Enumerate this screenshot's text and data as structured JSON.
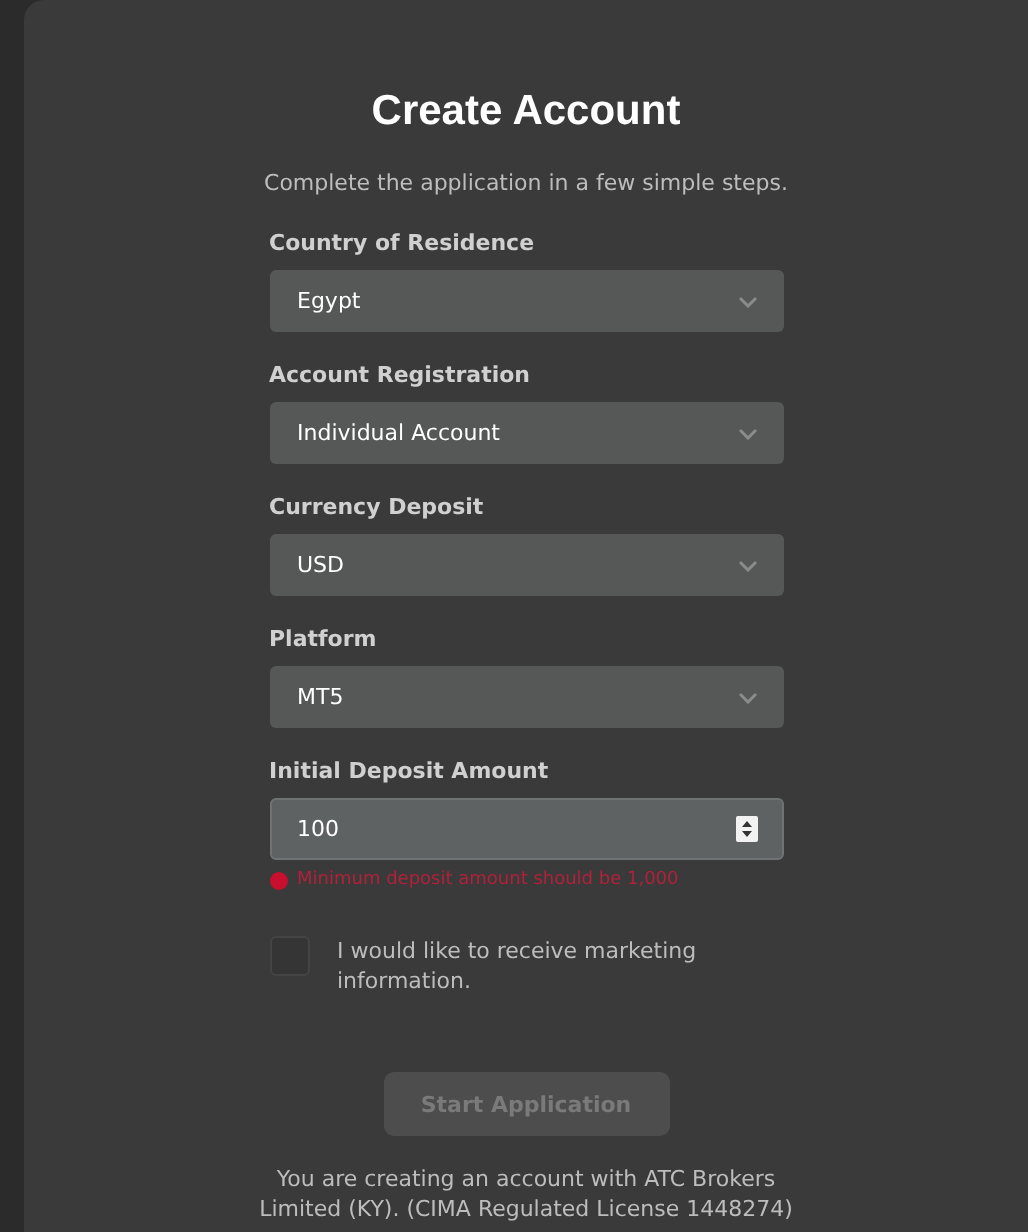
{
  "title": "Create Account",
  "subtitle": "Complete the application in a few simple steps.",
  "fields": [
    {
      "kind": "select",
      "label": "Country of Residence",
      "value": "Egypt"
    },
    {
      "kind": "select",
      "label": "Account Registration",
      "value": "Individual Account"
    },
    {
      "kind": "select",
      "label": "Currency Deposit",
      "value": "USD"
    },
    {
      "kind": "select",
      "label": "Platform",
      "value": "MT5"
    },
    {
      "kind": "number",
      "label": "Initial Deposit Amount",
      "value": "100",
      "error": "Minimum deposit amount should be 1,000"
    }
  ],
  "consent": {
    "label": "I would like to receive marketing information.",
    "checked": false
  },
  "submit": {
    "label": "Start Application",
    "disabled": true
  },
  "footnote": "You are creating an account with ATC Brokers Limited (KY). (CIMA Regulated License 1448274)"
}
